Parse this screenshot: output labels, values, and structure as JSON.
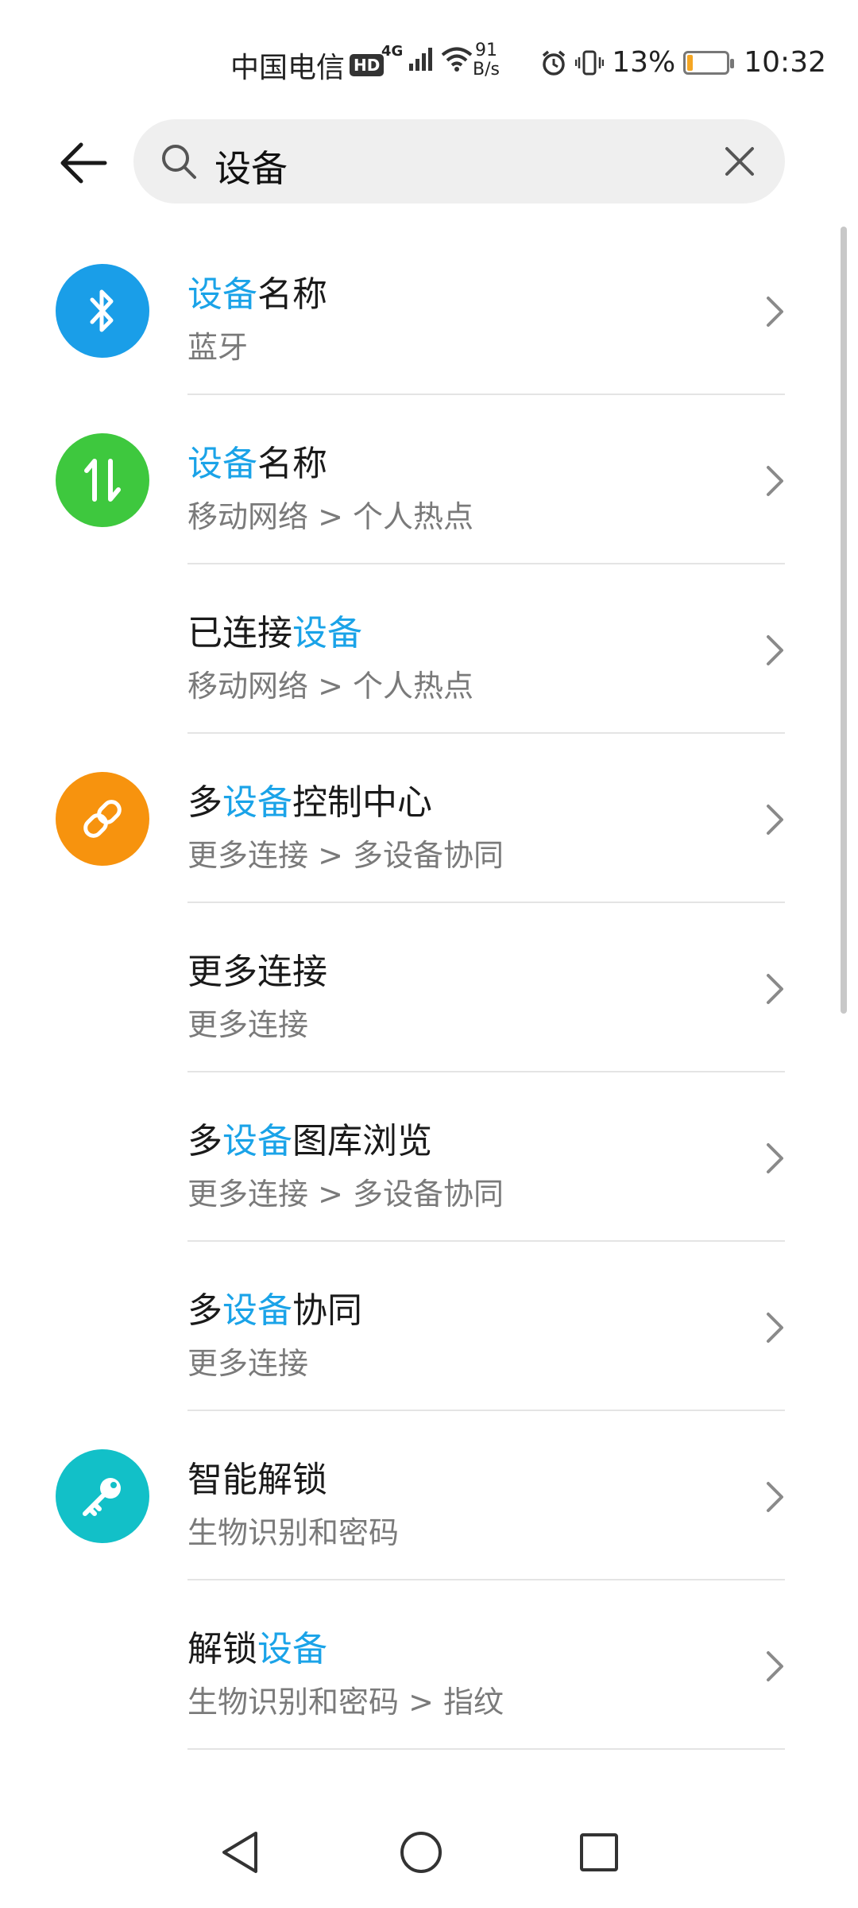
{
  "status_bar": {
    "carrier": "中国电信",
    "hd": "HD",
    "network": "4G",
    "speed_value": "91",
    "speed_unit": "B/s",
    "battery_percent": "13%",
    "battery_level": 0.13,
    "time": "10:32"
  },
  "search": {
    "query": "设备"
  },
  "results": [
    {
      "title_before": "",
      "highlight": "设备",
      "title_after": "名称",
      "subtitle": "蓝牙",
      "icon": "bluetooth-icon",
      "color": "#1a9ee8"
    },
    {
      "title_before": "",
      "highlight": "设备",
      "title_after": "名称",
      "subtitle": "移动网络 > 个人热点",
      "icon": "mobile-data-icon",
      "color": "#3ec83e"
    },
    {
      "title_before": "已连接",
      "highlight": "设备",
      "title_after": "",
      "subtitle": "移动网络 > 个人热点",
      "icon": "",
      "color": ""
    },
    {
      "title_before": "多",
      "highlight": "设备",
      "title_after": "控制中心",
      "subtitle": "更多连接 > 多设备协同",
      "icon": "link-icon",
      "color": "#f7930e"
    },
    {
      "title_before": "更多连接",
      "highlight": "",
      "title_after": "",
      "subtitle": "更多连接",
      "icon": "",
      "color": ""
    },
    {
      "title_before": "多",
      "highlight": "设备",
      "title_after": "图库浏览",
      "subtitle": "更多连接 > 多设备协同",
      "icon": "",
      "color": ""
    },
    {
      "title_before": "多",
      "highlight": "设备",
      "title_after": "协同",
      "subtitle": "更多连接",
      "icon": "",
      "color": ""
    },
    {
      "title_before": "智能解锁",
      "highlight": "",
      "title_after": "",
      "subtitle": "生物识别和密码",
      "icon": "key-icon",
      "color": "#12c0c8"
    },
    {
      "title_before": "解锁",
      "highlight": "设备",
      "title_after": "",
      "subtitle": "生物识别和密码 > 指纹",
      "icon": "",
      "color": ""
    }
  ],
  "colors": {
    "highlight": "#1aa3e8",
    "subtitle": "#7a7a7a"
  }
}
